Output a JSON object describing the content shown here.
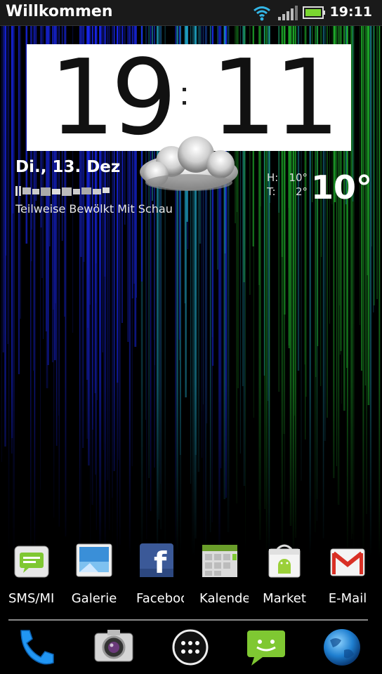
{
  "status": {
    "title": "Willkommen",
    "time": "19:11"
  },
  "clock": {
    "h1": "1",
    "h2": "9",
    "m1": "1",
    "m2": "1"
  },
  "weather": {
    "date": "Di., 13. Dez",
    "condition": "Teilweise Bewölkt Mit Schau",
    "high_label": "H:",
    "high_value": "10°",
    "low_label": "T:",
    "low_value": "2°",
    "current_temp": "10°"
  },
  "apps": [
    {
      "label": "SMS/MI",
      "icon": "sms-icon"
    },
    {
      "label": "Galerie",
      "icon": "gallery-icon"
    },
    {
      "label": "Facebook",
      "icon": "facebook-icon"
    },
    {
      "label": "Kalender",
      "icon": "calendar-icon"
    },
    {
      "label": "Market",
      "icon": "market-icon"
    },
    {
      "label": "E-Mail",
      "icon": "email-icon"
    }
  ],
  "dock": [
    {
      "icon": "phone-icon"
    },
    {
      "icon": "camera-icon"
    },
    {
      "icon": "app-drawer-icon"
    },
    {
      "icon": "messaging-icon"
    },
    {
      "icon": "browser-icon"
    }
  ],
  "colors": {
    "wall_blue": "#1a2aff",
    "wall_cyan": "#20a8c8",
    "wall_green": "#22c030",
    "battery": "#7ad630",
    "wifi": "#33b5e5"
  }
}
